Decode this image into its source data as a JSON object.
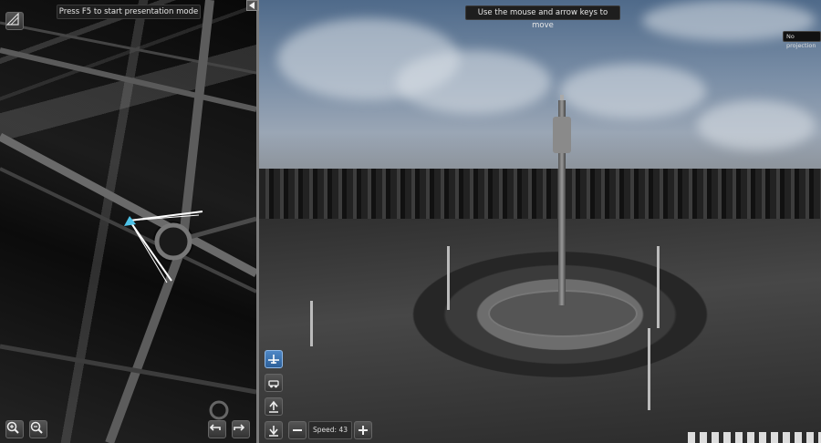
{
  "map": {
    "presentation_hint": "Press F5 to start presentation mode"
  },
  "viewer": {
    "move_hint": "Use the mouse and arrow keys to move",
    "projection_label": "No projection",
    "speed_label": "Speed:",
    "speed_value": "43"
  },
  "icons": {
    "map_corner": "ruler-icon",
    "zoom_in": "zoom-in-icon",
    "zoom_out": "zoom-out-icon",
    "undo": "undo-arrow-icon",
    "redo": "redo-arrow-icon",
    "toggle_left": "chevron-left-icon",
    "toggle_right": "chevron-right-icon",
    "fly_mode": "airplane-icon",
    "walk_mode": "car-icon",
    "move_up": "arrow-up-icon",
    "move_down": "arrow-down-icon",
    "decrease": "minus-icon",
    "increase": "plus-icon"
  },
  "colors": {
    "active_button": "#3a74b4",
    "camera_marker": "#4fc3e8"
  }
}
